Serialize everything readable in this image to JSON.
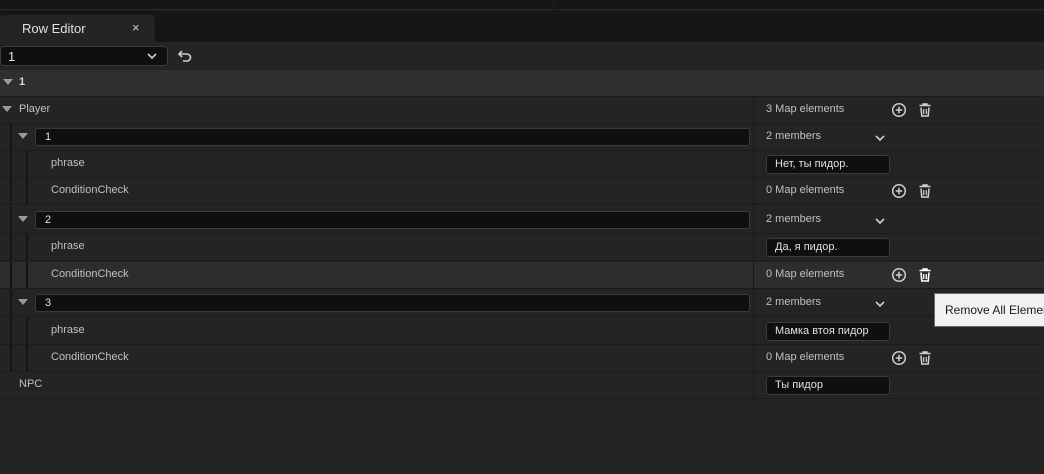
{
  "tab": {
    "label": "Row Editor",
    "close_label": "×"
  },
  "toolbar": {
    "row_select_value": "1"
  },
  "section_header": "1",
  "player": {
    "label": "Player",
    "summary": "3 Map elements"
  },
  "entries": [
    {
      "key": "1",
      "summary": "2 members",
      "phrase_label": "phrase",
      "phrase_value": "Нет, ты пидор.",
      "cond_label": "ConditionCheck",
      "cond_summary": "0 Map elements"
    },
    {
      "key": "2",
      "summary": "2 members",
      "phrase_label": "phrase",
      "phrase_value": "Да, я пидор.",
      "cond_label": "ConditionCheck",
      "cond_summary": "0 Map elements"
    },
    {
      "key": "3",
      "summary": "2 members",
      "phrase_label": "phrase",
      "phrase_value": "Мамка втоя пидор",
      "cond_label": "ConditionCheck",
      "cond_summary": "0 Map elements"
    }
  ],
  "npc": {
    "label": "NPC",
    "value": "Ты пидор"
  },
  "tooltip": "Remove All Elements",
  "icons": {
    "add": "add-circle-icon",
    "delete": "trash-icon",
    "expand": "triangle-down-icon",
    "chevron": "chevron-down-icon",
    "undo": "undo-icon"
  }
}
